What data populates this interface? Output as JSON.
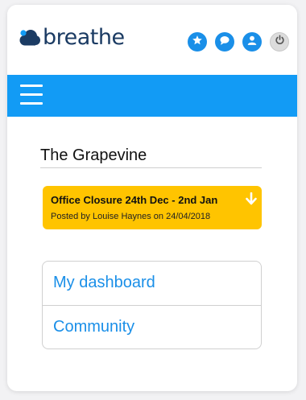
{
  "brand": {
    "logo_text": "breathe",
    "colors": {
      "navy": "#1b3b63",
      "blue": "#1a8fe8",
      "nav_bar": "#129bf5",
      "notice": "#ffc400"
    }
  },
  "header": {
    "icons": [
      "star-icon",
      "chat-icon",
      "user-icon",
      "power-icon"
    ]
  },
  "navbar": {
    "menu_icon": "hamburger-icon"
  },
  "page": {
    "title": "The Grapevine"
  },
  "notice": {
    "title": "Office Closure 24th Dec - 2nd Jan",
    "subtitle": "Posted by Louise Haynes on 24/04/2018",
    "icon": "arrow-down-icon"
  },
  "menu": {
    "items": [
      {
        "label": "My dashboard"
      },
      {
        "label": "Community"
      }
    ]
  }
}
